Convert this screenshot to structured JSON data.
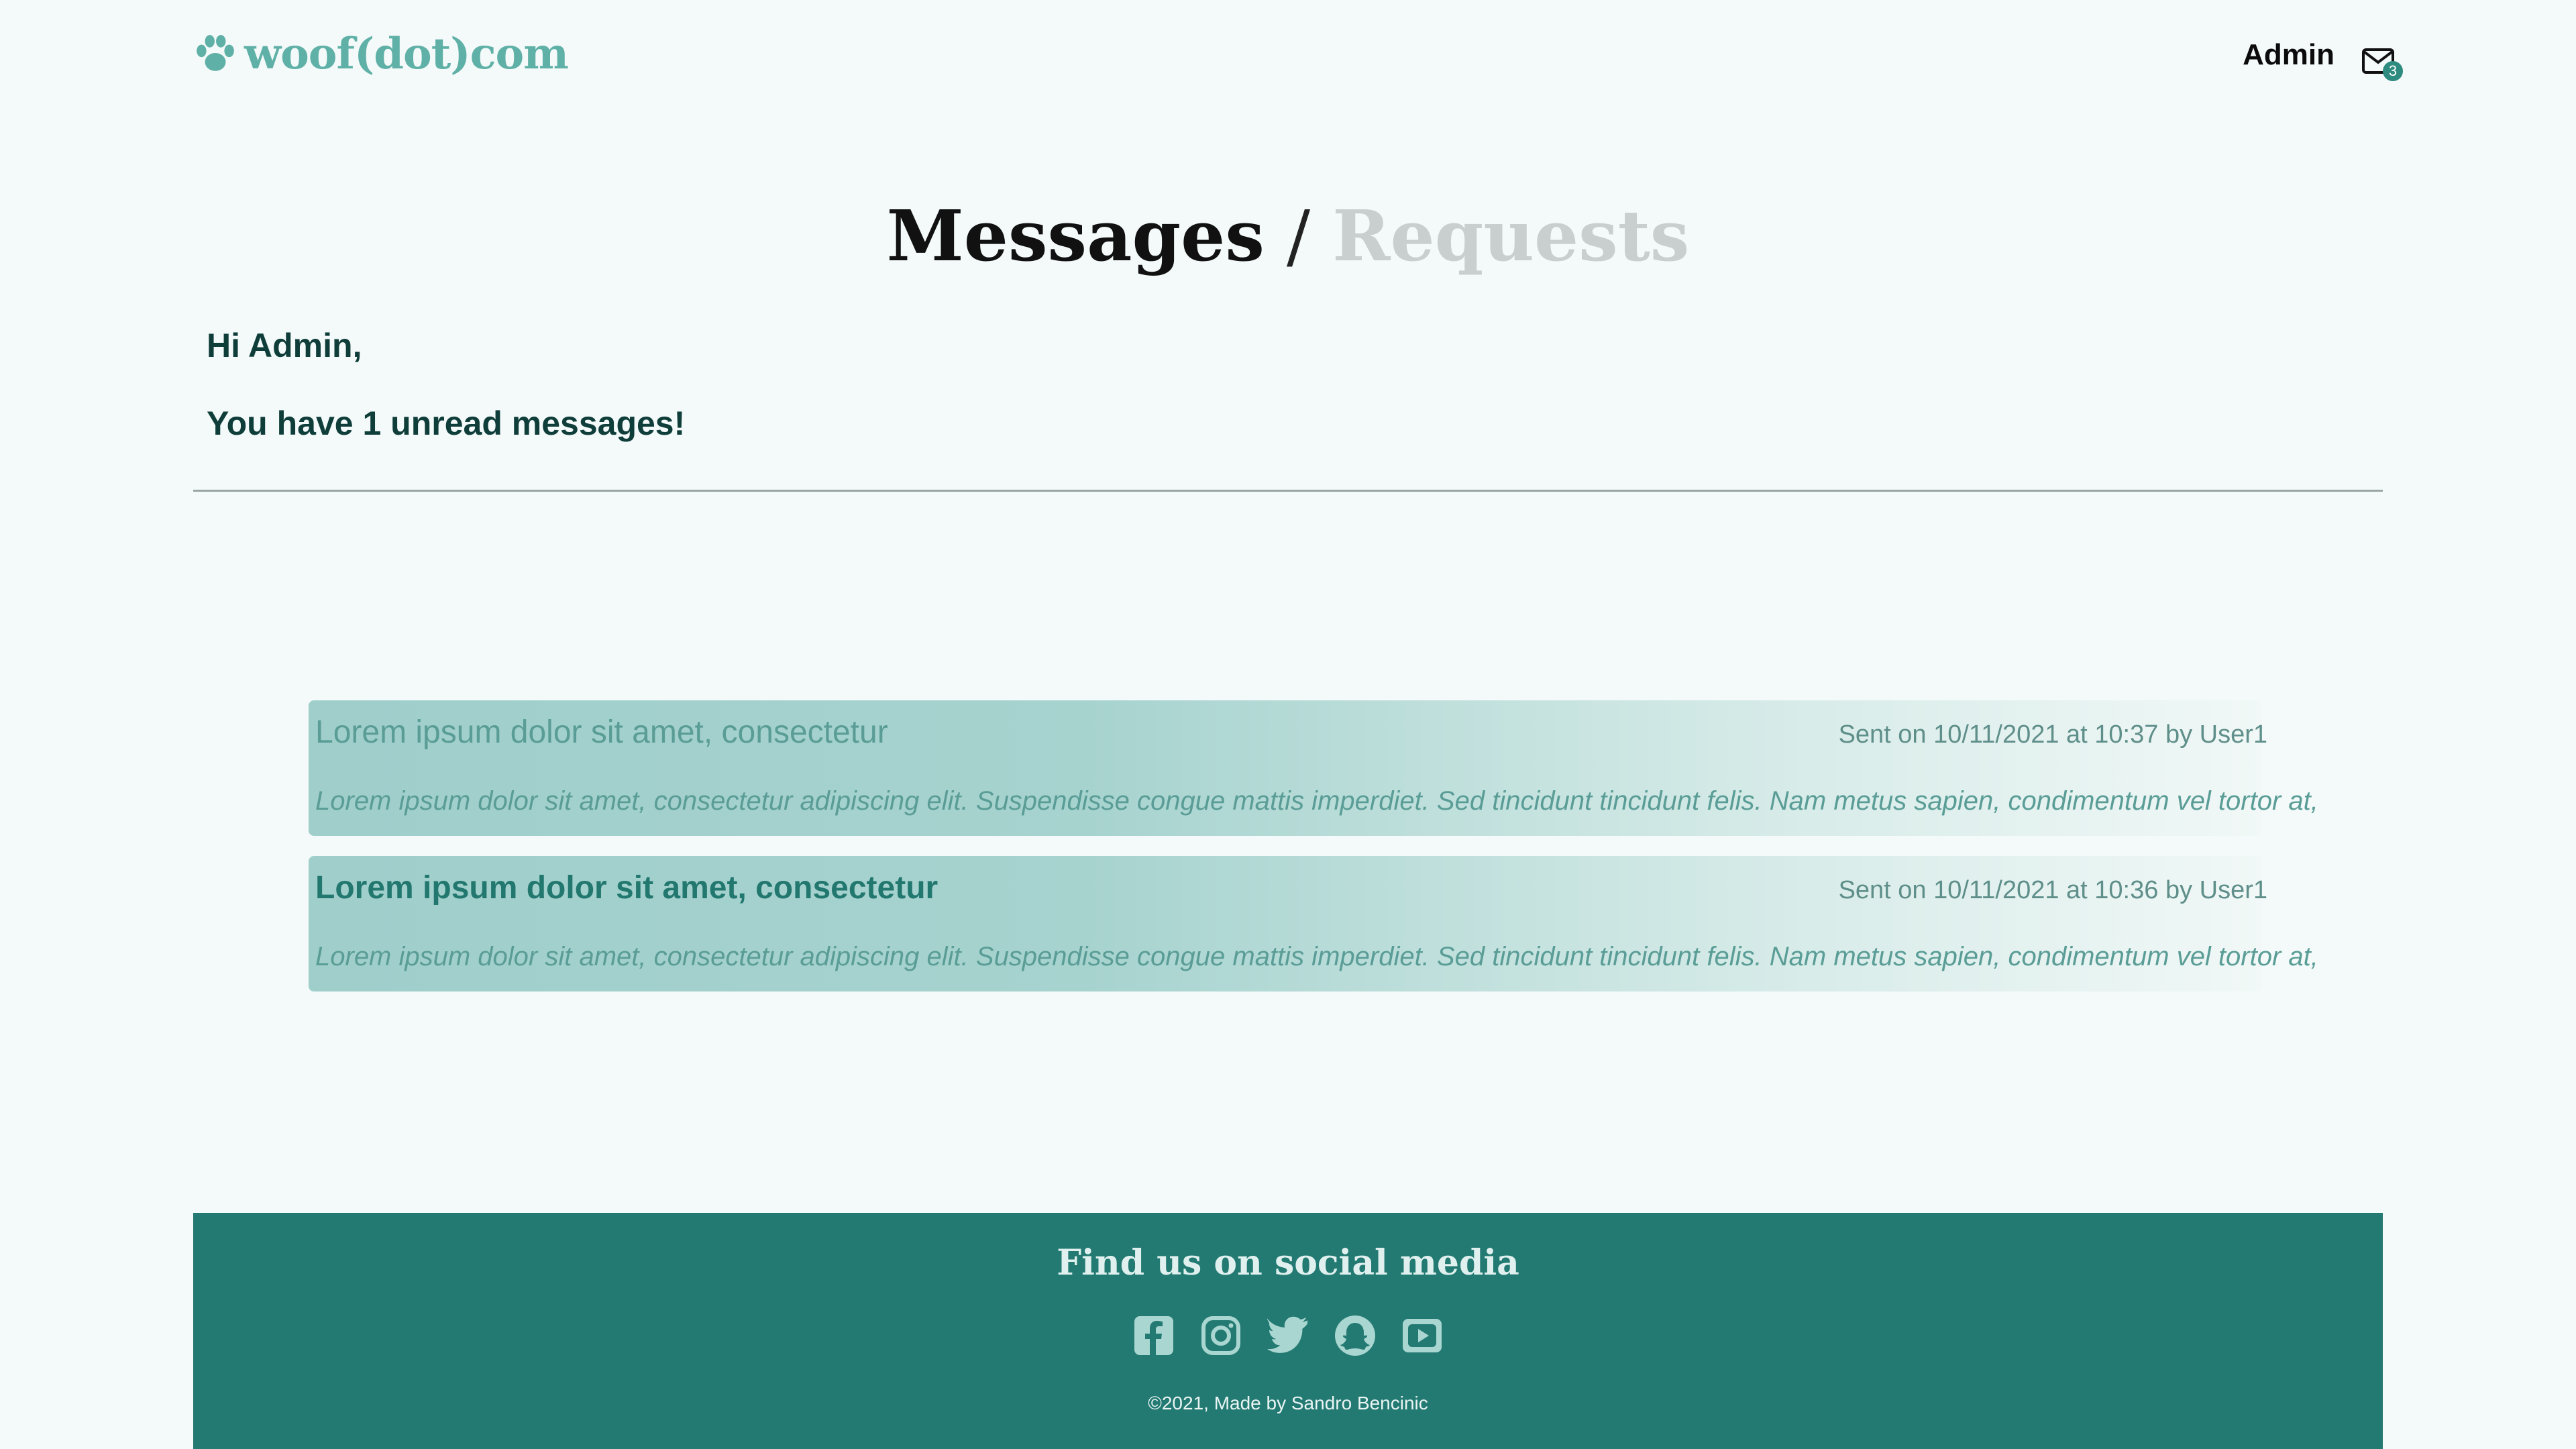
{
  "header": {
    "logo_text": "woof(dot)com",
    "logo_icon": "paw-icon",
    "nav_admin": "Admin",
    "mail_icon": "envelope-icon",
    "mail_badge": "3"
  },
  "title": {
    "messages": "Messages",
    "slash": "/",
    "requests": "Requests"
  },
  "greeting": "Hi Admin,",
  "unread_text": "You have 1 unread messages!",
  "messages": [
    {
      "subject": "Lorem ipsum dolor sit amet, consectetur",
      "meta": "Sent on 10/11/2021 at 10:37 by User1",
      "body": "Lorem ipsum dolor sit amet, consectetur adipiscing elit. Suspendisse congue mattis imperdiet. Sed tincidunt tincidunt felis. Nam metus sapien, condimentum vel tortor at,",
      "unread": false
    },
    {
      "subject": "Lorem ipsum dolor sit amet, consectetur",
      "meta": "Sent on 10/11/2021 at 10:36 by User1",
      "body": "Lorem ipsum dolor sit amet, consectetur adipiscing elit. Suspendisse congue mattis imperdiet. Sed tincidunt tincidunt felis. Nam metus sapien, condimentum vel tortor at,",
      "unread": true
    }
  ],
  "footer": {
    "title": "Find us on social media",
    "socials": [
      "facebook-icon",
      "instagram-icon",
      "twitter-icon",
      "snapchat-icon",
      "youtube-icon"
    ],
    "copyright": "©2021, Made by Sandro Bencinic"
  },
  "colors": {
    "accent": "#237a72",
    "background": "#f3faf9",
    "logo": "#5fb0a7"
  }
}
